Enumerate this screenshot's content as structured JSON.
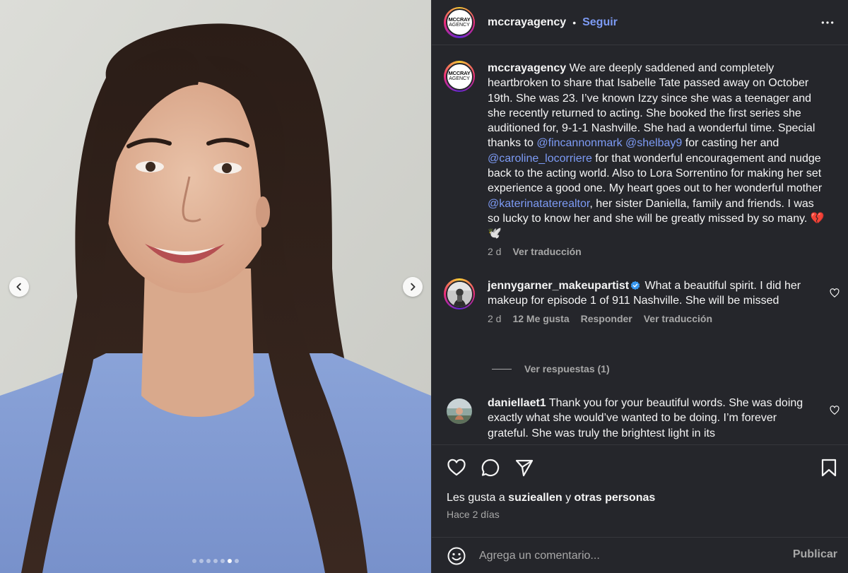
{
  "carousel": {
    "prev_label": "Anterior",
    "next_label": "Siguiente",
    "dot_count": 7,
    "active_index": 5
  },
  "header": {
    "username": "mccrayagency",
    "separator": "•",
    "follow_label": "Seguir",
    "logo_line1": "MCCRAY",
    "logo_line2": "AGENCY"
  },
  "caption": {
    "username": "mccrayagency",
    "text_1": " We are deeply saddened and completely heartbroken to share that Isabelle Tate passed away on October 19th. She was 23. I’ve known Izzy since she was a teenager and she recently returned to acting. She booked the first series she auditioned for, 9-1-1 Nashville. She had a wonderful time. Special thanks to ",
    "mention_1": "@fincannonmark",
    "space": " ",
    "mention_2": "@shelbay9",
    "text_2": " for casting her and ",
    "mention_3": "@caroline_locorriere",
    "text_3": " for that wonderful encouragement and nudge back to the acting world. Also to Lora Sorrentino for making her set experience a good one. My heart goes out to her wonderful mother ",
    "mention_4": "@katerinatatere altor",
    "mention_4_display": "@katerinataterealtor",
    "text_4": ", her sister Daniella, family and friends. I was so lucky to know her and she will be greatly missed by so many. 💔🕊️",
    "time": "2 d",
    "translate": "Ver traducción"
  },
  "comments": [
    {
      "username": "jennygarner_makeupartist",
      "text": " What a beautiful spirit. I did her makeup for episode 1 of 911 Nashville. She will be missed",
      "time": "2 d",
      "likes": "12 Me gusta",
      "reply": "Responder",
      "translate": "Ver traducción",
      "verified": true
    },
    {
      "username": "daniellaet1",
      "text": " Thank you for your beautiful words. She was doing exactly what she would’ve wanted to be doing. I’m forever grateful. She was truly the brightest light in its",
      "verified": false
    }
  ],
  "replies_label": "Ver respuestas (1)",
  "footer": {
    "likes_prefix": "Les gusta a ",
    "likes_user": "suzieallen",
    "likes_middle": " y ",
    "likes_others": "otras personas",
    "date": "Hace 2 días",
    "comment_placeholder": "Agrega un comentario...",
    "publish_label": "Publicar"
  },
  "colors": {
    "panel_bg": "#25262b",
    "link_blue": "#7d9bf5",
    "muted": "#a8a8a8",
    "text": "#f5f5f5"
  }
}
